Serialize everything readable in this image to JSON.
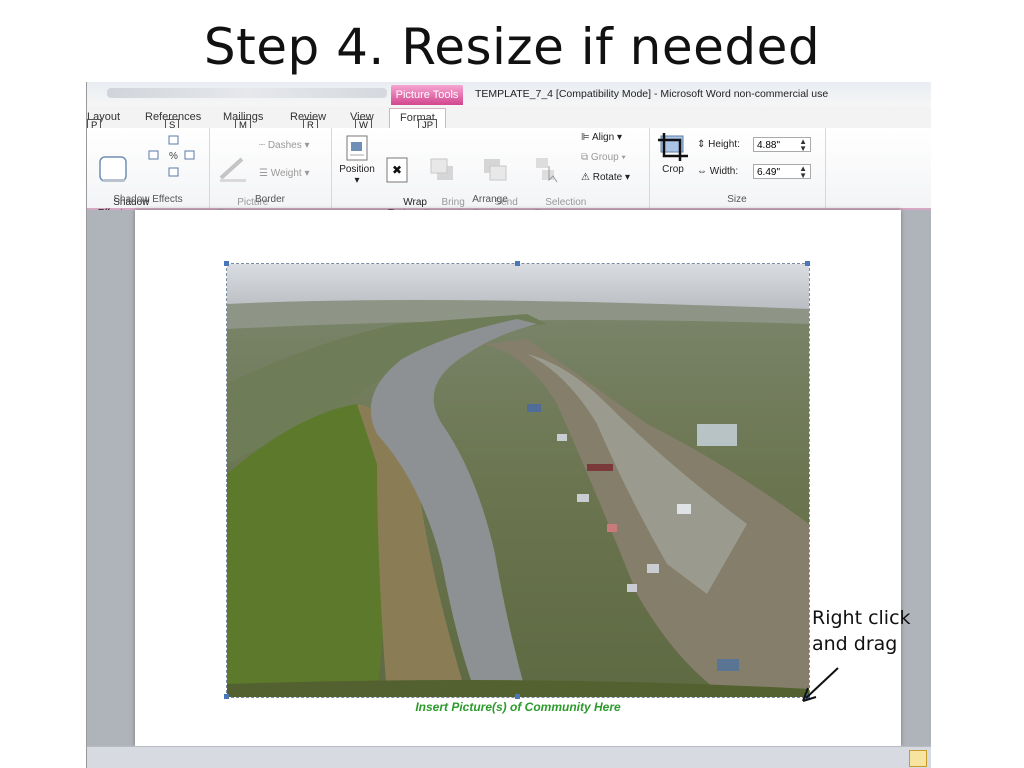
{
  "slide": {
    "title": "Step 4. Resize if needed"
  },
  "window": {
    "context_tab": "Picture Tools",
    "doc_title": "TEMPLATE_7_4 [Compatibility Mode]  -  Microsoft Word non-commercial use"
  },
  "tabs": [
    {
      "label": "Layout",
      "key": "P"
    },
    {
      "label": "References",
      "key": "S"
    },
    {
      "label": "Mailings",
      "key": "M"
    },
    {
      "label": "Review",
      "key": "R"
    },
    {
      "label": "View",
      "key": "W"
    },
    {
      "label": "Format",
      "key": "JP"
    }
  ],
  "ribbon": {
    "shadow": {
      "button": "Shadow\nEffects",
      "group": "Shadow Effects"
    },
    "border": {
      "picture_border": "Picture\nBorder",
      "dashes": "Dashes",
      "weight": "Weight",
      "group": "Border"
    },
    "arrange": {
      "position": "Position",
      "wrap": "Wrap\nText",
      "bring": "Bring\nForward",
      "send": "Send\nBackward",
      "selection": "Selection\nPane",
      "align": "Align",
      "group_btn": "Group",
      "rotate": "Rotate",
      "group": "Arrange"
    },
    "size": {
      "crop": "Crop",
      "height_label": "Height:",
      "height_value": "4.88\"",
      "width_label": "Width:",
      "width_value": "6.49\"",
      "group": "Size"
    }
  },
  "document": {
    "caption": "Insert Picture(s) of Community Here"
  },
  "annotation": {
    "line1": "Right click",
    "line2": "and drag"
  },
  "colors": {
    "picture_tools": "#d2468e",
    "caption": "#2b9a2b"
  }
}
